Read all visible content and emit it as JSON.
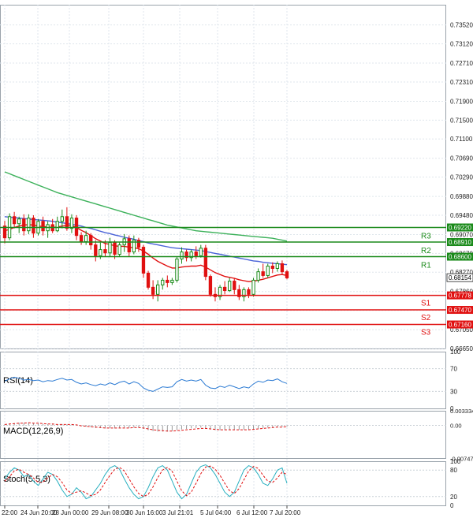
{
  "chart_data": [
    {
      "type": "candlestick",
      "pane": "price",
      "title": "",
      "ylim": [
        0.6665,
        0.7395
      ],
      "y_ticks": [
        "0.73520",
        "0.73120",
        "0.72710",
        "0.72310",
        "0.71900",
        "0.71500",
        "0.71100",
        "0.70690",
        "0.70290",
        "0.69880",
        "0.69480",
        "0.69070",
        "0.68670",
        "0.68270",
        "0.67860",
        "0.67460",
        "0.67050",
        "0.66650"
      ],
      "x_ticks": [
        "22:00",
        "24 Jun 20:00",
        "28 Jun 00:00",
        "29 Jun 08:00",
        "30 Jun 16:00",
        "3 Jul 21:01",
        "5 Jul 04:00",
        "6 Jul 12:00",
        "7 Jul 20:00"
      ],
      "current_price": "0.68154",
      "ohlc": [
        [
          0.6925,
          0.6936,
          0.6888,
          0.69
        ],
        [
          0.69,
          0.6952,
          0.6895,
          0.6945
        ],
        [
          0.6945,
          0.6955,
          0.692,
          0.693
        ],
        [
          0.693,
          0.6945,
          0.691,
          0.694
        ],
        [
          0.694,
          0.695,
          0.6905,
          0.6915
        ],
        [
          0.6915,
          0.695,
          0.6908,
          0.6942
        ],
        [
          0.6942,
          0.6948,
          0.69,
          0.691
        ],
        [
          0.691,
          0.694,
          0.6905,
          0.6935
        ],
        [
          0.6935,
          0.6945,
          0.6905,
          0.6915
        ],
        [
          0.6915,
          0.6935,
          0.69,
          0.6928
        ],
        [
          0.6928,
          0.694,
          0.691,
          0.6915
        ],
        [
          0.6915,
          0.6945,
          0.6912,
          0.6935
        ],
        [
          0.6935,
          0.696,
          0.692,
          0.6945
        ],
        [
          0.6945,
          0.6965,
          0.6915,
          0.692
        ],
        [
          0.692,
          0.695,
          0.691,
          0.6942
        ],
        [
          0.6942,
          0.6948,
          0.6895,
          0.6905
        ],
        [
          0.6905,
          0.6912,
          0.6885,
          0.6892
        ],
        [
          0.6892,
          0.6915,
          0.6885,
          0.6905
        ],
        [
          0.6905,
          0.691,
          0.6875,
          0.6885
        ],
        [
          0.6885,
          0.6895,
          0.685,
          0.6862
        ],
        [
          0.6862,
          0.689,
          0.6855,
          0.6875
        ],
        [
          0.6875,
          0.6895,
          0.686,
          0.6868
        ],
        [
          0.6868,
          0.69,
          0.686,
          0.689
        ],
        [
          0.689,
          0.6895,
          0.6855,
          0.6865
        ],
        [
          0.6865,
          0.689,
          0.686,
          0.6885
        ],
        [
          0.6885,
          0.6908,
          0.687,
          0.6898
        ],
        [
          0.6898,
          0.6905,
          0.686,
          0.687
        ],
        [
          0.687,
          0.6905,
          0.6865,
          0.6895
        ],
        [
          0.6895,
          0.69,
          0.687,
          0.688
        ],
        [
          0.688,
          0.6885,
          0.6815,
          0.6825
        ],
        [
          0.6825,
          0.683,
          0.679,
          0.6795
        ],
        [
          0.6795,
          0.681,
          0.677,
          0.678
        ],
        [
          0.678,
          0.681,
          0.6765,
          0.68
        ],
        [
          0.68,
          0.6815,
          0.679,
          0.681
        ],
        [
          0.681,
          0.682,
          0.6795,
          0.6805
        ],
        [
          0.6805,
          0.6815,
          0.68,
          0.681
        ],
        [
          0.681,
          0.686,
          0.6805,
          0.6855
        ],
        [
          0.6855,
          0.688,
          0.6845,
          0.687
        ],
        [
          0.687,
          0.6875,
          0.685,
          0.6858
        ],
        [
          0.6858,
          0.6875,
          0.685,
          0.687
        ],
        [
          0.687,
          0.6882,
          0.6855,
          0.6862
        ],
        [
          0.6862,
          0.6885,
          0.6858,
          0.6878
        ],
        [
          0.6878,
          0.6885,
          0.681,
          0.6818
        ],
        [
          0.6818,
          0.6822,
          0.6775,
          0.678
        ],
        [
          0.678,
          0.6795,
          0.6765,
          0.6775
        ],
        [
          0.6775,
          0.68,
          0.6768,
          0.6795
        ],
        [
          0.6795,
          0.6808,
          0.678,
          0.6788
        ],
        [
          0.6788,
          0.6815,
          0.6785,
          0.6808
        ],
        [
          0.6808,
          0.6815,
          0.678,
          0.679
        ],
        [
          0.679,
          0.68,
          0.6768,
          0.6775
        ],
        [
          0.6775,
          0.6795,
          0.6765,
          0.679
        ],
        [
          0.679,
          0.6795,
          0.6772,
          0.678
        ],
        [
          0.678,
          0.6815,
          0.6775,
          0.681
        ],
        [
          0.681,
          0.6835,
          0.6805,
          0.6828
        ],
        [
          0.6828,
          0.6845,
          0.6815,
          0.682
        ],
        [
          0.682,
          0.6845,
          0.6815,
          0.684
        ],
        [
          0.684,
          0.6848,
          0.6825,
          0.6835
        ],
        [
          0.6835,
          0.685,
          0.6828,
          0.6845
        ],
        [
          0.6845,
          0.6852,
          0.6822,
          0.6828
        ],
        [
          0.6828,
          0.6832,
          0.6812,
          0.6815
        ]
      ],
      "ma_fast": [
        0.6915,
        0.6918,
        0.6922,
        0.6925,
        0.6927,
        0.6928,
        0.6927,
        0.6925,
        0.6924,
        0.6923,
        0.6922,
        0.6923,
        0.6925,
        0.6926,
        0.6926,
        0.6922,
        0.6916,
        0.6911,
        0.6905,
        0.6898,
        0.6893,
        0.6888,
        0.6886,
        0.6883,
        0.6882,
        0.6882,
        0.688,
        0.6879,
        0.6877,
        0.6872,
        0.6865,
        0.6857,
        0.685,
        0.6845,
        0.684,
        0.6836,
        0.6836,
        0.6838,
        0.6839,
        0.684,
        0.684,
        0.6842,
        0.6838,
        0.6832,
        0.6826,
        0.6822,
        0.6818,
        0.6816,
        0.6814,
        0.6811,
        0.6809,
        0.6807,
        0.6808,
        0.681,
        0.6812,
        0.6815,
        0.6818,
        0.6821,
        0.6822,
        0.682
      ],
      "ma_mid": [
        0.6945,
        0.6944,
        0.6943,
        0.6942,
        0.6941,
        0.694,
        0.6939,
        0.6938,
        0.6937,
        0.6936,
        0.6935,
        0.6933,
        0.6932,
        0.693,
        0.6929,
        0.6927,
        0.6925,
        0.6922,
        0.692,
        0.6917,
        0.6914,
        0.6911,
        0.6909,
        0.6906,
        0.6904,
        0.6901,
        0.6899,
        0.6897,
        0.6894,
        0.6892,
        0.6889,
        0.6887,
        0.6885,
        0.6883,
        0.6881,
        0.6879,
        0.6878,
        0.6877,
        0.6876,
        0.6875,
        0.6874,
        0.6873,
        0.6871,
        0.6869,
        0.6867,
        0.6865,
        0.6863,
        0.6861,
        0.6859,
        0.6857,
        0.6855,
        0.6853,
        0.6851,
        0.685,
        0.6848,
        0.6847,
        0.6846,
        0.6845,
        0.6844,
        0.6843
      ],
      "ma_slow": [
        0.704,
        0.7036,
        0.7032,
        0.7028,
        0.7024,
        0.702,
        0.7016,
        0.7012,
        0.7008,
        0.7004,
        0.7,
        0.6996,
        0.6993,
        0.699,
        0.6987,
        0.6984,
        0.6981,
        0.6978,
        0.6975,
        0.6972,
        0.6969,
        0.6966,
        0.6963,
        0.696,
        0.6957,
        0.6954,
        0.6951,
        0.6948,
        0.6945,
        0.6942,
        0.6939,
        0.6936,
        0.6933,
        0.693,
        0.6927,
        0.6925,
        0.6923,
        0.6921,
        0.6919,
        0.6917,
        0.6915,
        0.6914,
        0.6913,
        0.6912,
        0.6911,
        0.691,
        0.6909,
        0.6908,
        0.6907,
        0.6906,
        0.6905,
        0.6904,
        0.6903,
        0.6902,
        0.6901,
        0.69,
        0.6899,
        0.6897,
        0.6895,
        0.6893
      ],
      "levels": [
        {
          "label": "R3",
          "value": 0.6922,
          "text": "0.69220",
          "color": "#1a8a1a"
        },
        {
          "label": "R2",
          "value": 0.6891,
          "text": "0.68910",
          "color": "#1a8a1a"
        },
        {
          "label": "R1",
          "value": 0.686,
          "text": "0.68600",
          "color": "#1a8a1a"
        },
        {
          "label": "S1",
          "value": 0.67778,
          "text": "0.67778",
          "color": "#e01010"
        },
        {
          "label": "S2",
          "value": 0.6747,
          "text": "0.67470",
          "color": "#e01010"
        },
        {
          "label": "S3",
          "value": 0.6716,
          "text": "0.67160",
          "color": "#e01010"
        }
      ],
      "colors": {
        "bull": "#1a8a1a",
        "bear": "#e01010",
        "ma_fast": "#e01010",
        "ma_mid": "#4a63d8",
        "ma_slow": "#3cb15a",
        "grid": "#dfe6ec",
        "current_tag_bg": "#ffffff"
      }
    },
    {
      "type": "line",
      "pane": "rsi",
      "legend": "RSI(14)",
      "ylim": [
        0,
        100
      ],
      "y_ticks": [
        "100",
        "70",
        "30",
        "0"
      ],
      "values": [
        48,
        52,
        55,
        53,
        50,
        51,
        49,
        50,
        47,
        49,
        48,
        51,
        53,
        50,
        51,
        46,
        43,
        45,
        42,
        40,
        43,
        41,
        45,
        42,
        46,
        48,
        43,
        47,
        44,
        36,
        32,
        30,
        34,
        38,
        37,
        38,
        47,
        51,
        48,
        50,
        48,
        51,
        41,
        36,
        35,
        39,
        37,
        41,
        38,
        35,
        38,
        36,
        43,
        48,
        46,
        50,
        49,
        52,
        47,
        44
      ],
      "color": "#2b7ad3"
    },
    {
      "type": "bar",
      "pane": "macd",
      "legend": "MACD(12,26,9)",
      "ylim": [
        -0.0074,
        0.0033
      ],
      "y_ticks": [
        "0.003334",
        "0.00",
        "-0.007471"
      ],
      "histogram": [
        0.0003,
        0.0004,
        0.0005,
        0.0006,
        0.0006,
        0.0006,
        0.0005,
        0.0004,
        0.0003,
        0.0003,
        0.0002,
        0.0002,
        0.0003,
        0.0002,
        0.0002,
        0.0,
        -0.0002,
        -0.0003,
        -0.0004,
        -0.0006,
        -0.0006,
        -0.0007,
        -0.0006,
        -0.0007,
        -0.0006,
        -0.0005,
        -0.0006,
        -0.0005,
        -0.0005,
        -0.0008,
        -0.0011,
        -0.0013,
        -0.0014,
        -0.0014,
        -0.0014,
        -0.0013,
        -0.0011,
        -0.0009,
        -0.0008,
        -0.0007,
        -0.0006,
        -0.0005,
        -0.0007,
        -0.0009,
        -0.0011,
        -0.0011,
        -0.0011,
        -0.001,
        -0.001,
        -0.001,
        -0.001,
        -0.001,
        -0.0009,
        -0.0007,
        -0.0006,
        -0.0005,
        -0.0004,
        -0.0003,
        -0.0003,
        -0.0003
      ],
      "signal": [
        0.0002,
        0.0003,
        0.0004,
        0.0005,
        0.0005,
        0.0006,
        0.0005,
        0.0005,
        0.0004,
        0.0003,
        0.0003,
        0.0002,
        0.0002,
        0.0002,
        0.0002,
        0.0001,
        -0.0001,
        -0.0002,
        -0.0003,
        -0.0004,
        -0.0005,
        -0.0006,
        -0.0006,
        -0.0006,
        -0.0006,
        -0.0006,
        -0.0006,
        -0.0005,
        -0.0005,
        -0.0006,
        -0.0008,
        -0.001,
        -0.0011,
        -0.0012,
        -0.0013,
        -0.0013,
        -0.0012,
        -0.0011,
        -0.001,
        -0.0009,
        -0.0008,
        -0.0007,
        -0.0007,
        -0.0008,
        -0.0009,
        -0.001,
        -0.001,
        -0.001,
        -0.001,
        -0.001,
        -0.001,
        -0.001,
        -0.0009,
        -0.0008,
        -0.0007,
        -0.0006,
        -0.0005,
        -0.0004,
        -0.0004,
        -0.0003
      ],
      "colors": {
        "histogram": "#9a9a9a",
        "signal": "#e01010"
      }
    },
    {
      "type": "line",
      "pane": "stoch",
      "legend": "Stoch(5,5,3)",
      "ylim": [
        0,
        100
      ],
      "y_ticks": [
        "100",
        "80",
        "20",
        "0"
      ],
      "main": [
        60,
        75,
        85,
        80,
        65,
        70,
        55,
        45,
        60,
        75,
        70,
        55,
        35,
        20,
        25,
        40,
        30,
        15,
        20,
        35,
        50,
        70,
        85,
        90,
        82,
        60,
        40,
        25,
        15,
        20,
        40,
        65,
        85,
        90,
        80,
        55,
        30,
        15,
        25,
        50,
        75,
        88,
        92,
        85,
        70,
        50,
        30,
        20,
        30,
        55,
        80,
        90,
        85,
        70,
        50,
        45,
        60,
        80,
        85,
        50
      ],
      "signal": [
        55,
        65,
        78,
        82,
        75,
        70,
        62,
        52,
        53,
        62,
        70,
        65,
        52,
        35,
        27,
        30,
        33,
        28,
        22,
        25,
        35,
        52,
        68,
        82,
        86,
        78,
        60,
        42,
        27,
        20,
        25,
        42,
        63,
        80,
        86,
        77,
        55,
        33,
        22,
        30,
        50,
        72,
        87,
        89,
        82,
        68,
        50,
        33,
        27,
        38,
        58,
        78,
        88,
        84,
        68,
        55,
        52,
        62,
        75,
        70
      ],
      "colors": {
        "main": "#2ab0c0",
        "signal": "#e01010"
      }
    }
  ]
}
